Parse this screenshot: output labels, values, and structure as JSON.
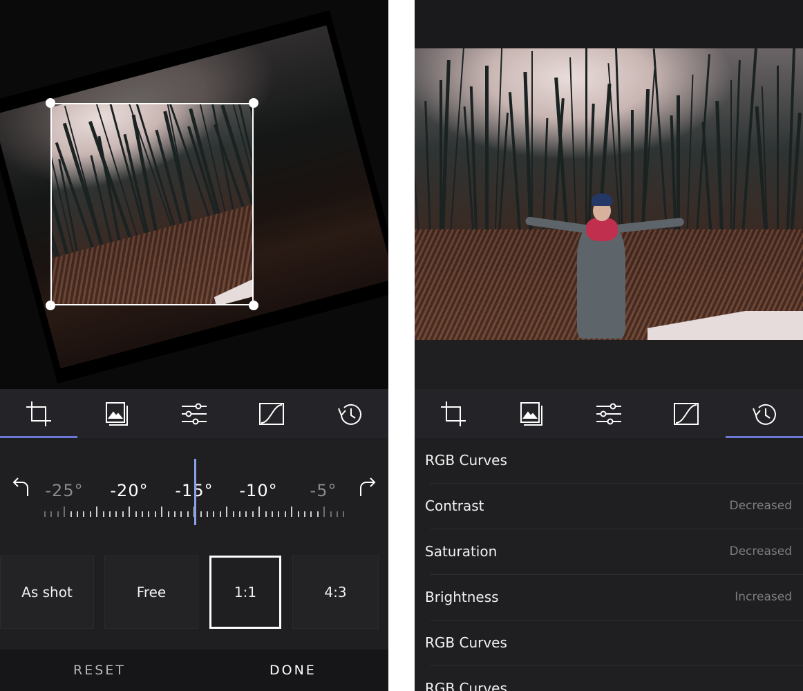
{
  "left": {
    "toolbar": [
      {
        "icon": "crop-icon",
        "active": true
      },
      {
        "icon": "filters-icon",
        "active": false
      },
      {
        "icon": "adjust-sliders-icon",
        "active": false
      },
      {
        "icon": "curves-icon",
        "active": false
      },
      {
        "icon": "history-icon",
        "active": false
      }
    ],
    "rotation": {
      "ticks_labels": [
        "-25°",
        "-20°",
        "-15°",
        "-10°",
        "-5°"
      ],
      "current_value": -15
    },
    "ratios": [
      "As shot",
      "Free",
      "1:1",
      "4:3"
    ],
    "selected_ratio": "1:1",
    "actions": {
      "reset": "RESET",
      "done": "DONE"
    }
  },
  "right": {
    "toolbar": [
      {
        "icon": "crop-icon",
        "active": false
      },
      {
        "icon": "filters-icon",
        "active": false
      },
      {
        "icon": "adjust-sliders-icon",
        "active": false
      },
      {
        "icon": "curves-icon",
        "active": false
      },
      {
        "icon": "history-icon",
        "active": true
      }
    ],
    "history": [
      {
        "title": "RGB Curves",
        "status": ""
      },
      {
        "title": "Contrast",
        "status": "Decreased"
      },
      {
        "title": "Saturation",
        "status": "Decreased"
      },
      {
        "title": "Brightness",
        "status": "Increased"
      },
      {
        "title": "RGB Curves",
        "status": ""
      },
      {
        "title": "RGB Curves",
        "status": ""
      }
    ]
  },
  "colors": {
    "accent": "#6b78d6",
    "needle": "#8aa2e6",
    "background": "#1f1f21"
  }
}
